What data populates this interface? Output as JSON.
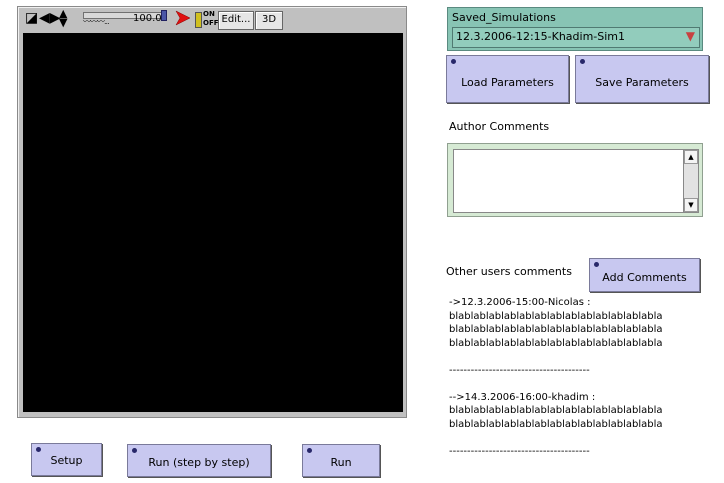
{
  "view": {
    "speed_value": "100.0",
    "edit_label": "Edit...",
    "threed_label": "3D",
    "onoff_on": "ON",
    "onoff_off": "OFF"
  },
  "buttons": {
    "setup": "Setup",
    "run_step": "Run (step by step)",
    "run": "Run",
    "load_parameters": "Load Parameters",
    "save_parameters": "Save Parameters",
    "add_comments": "Add Comments"
  },
  "chooser": {
    "label": "Saved_Simulations",
    "value": "12.3.2006-12:15-Khadim-Sim1"
  },
  "author": {
    "label": "Author Comments",
    "value": ""
  },
  "other": {
    "label": "Other users comments"
  },
  "comments": {
    "block1_header": "->12.3.2006-15:00-Nicolas :",
    "block1_lines": [
      "blablablablablablablablablablablablablabla",
      "blablablablablablablablablablablablablabla",
      "blablablablablablablablablablablablablabla"
    ],
    "divider1": "---------------------------------------",
    "block2_header": "-->14.3.2006-16:00-khadim :",
    "block2_lines": [
      "blablablablablablablablablablablablablabla",
      "blablablablablablablablablablablablablabla"
    ],
    "divider2": "---------------------------------------"
  },
  "colors": {
    "button_bg": "#c8c8f0",
    "chooser_bg": "#88c4b4",
    "input_panel_bg": "#d6ead4",
    "world_bg": "#000000"
  },
  "icons": [
    "fullscreen-icon",
    "pan-horizontal-icon",
    "pan-vertical-icon",
    "run-arrow-icon",
    "on-off-switch-icon",
    "chooser-dropdown-icon",
    "scroll-up-icon",
    "scroll-down-icon"
  ]
}
